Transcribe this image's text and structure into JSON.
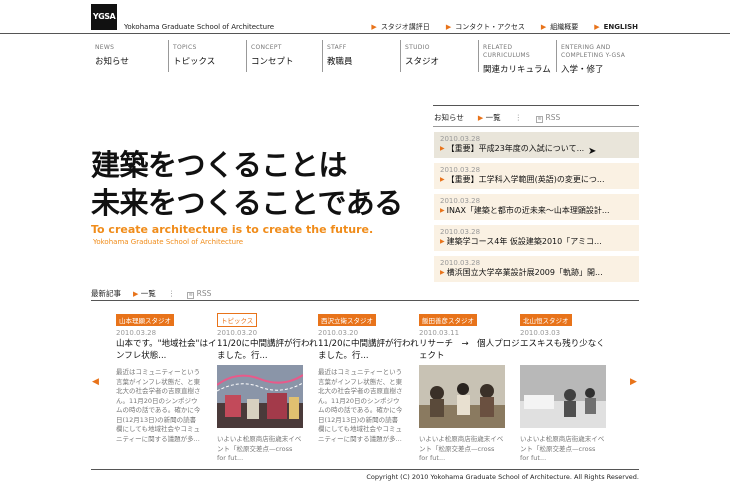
{
  "header": {
    "logo": "YGSA",
    "school_name": "Yokohama Graduate School of Architecture",
    "util_nav": [
      "スタジオ講評日",
      "コンタクト・アクセス",
      "組織概要",
      "ENGLISH"
    ]
  },
  "mainnav": [
    {
      "en": "NEWS",
      "jp": "お知らせ"
    },
    {
      "en": "TOPICS",
      "jp": "トピックス"
    },
    {
      "en": "CONCEPT",
      "jp": "コンセプト"
    },
    {
      "en": "STAFF",
      "jp": "教職員"
    },
    {
      "en": "STUDIO",
      "jp": "スタジオ"
    },
    {
      "en": "RELATED\nCURRICULUMS",
      "jp": "関連カリキュラム"
    },
    {
      "en": "ENTERING AND\nCOMPLETING Y-GSA",
      "jp": "入学・修了"
    }
  ],
  "hero": {
    "line1": "建築をつくることは",
    "line2": "未来をつくることである",
    "en": "To create architecture is to create the future.",
    "sub": "Yokohama Graduate School of Architecture"
  },
  "news": {
    "title": "お知らせ",
    "list_link": "一覧",
    "rss": "RSS",
    "items": [
      {
        "date": "2010.03.28",
        "title": "【重要】平成23年度の入試について..."
      },
      {
        "date": "2010.03.28",
        "title": "【重要】工学科入学範囲(英語)の変更につ..."
      },
      {
        "date": "2010.03.28",
        "title": "INAX「建築と都市の近未来〜山本理顕設計..."
      },
      {
        "date": "2010.03.28",
        "title": "建築学コース4年 仮設建築2010「アミコ..."
      },
      {
        "date": "2010.03.28",
        "title": "横浜国立大学卒業設計展2009「軌跡」開..."
      }
    ]
  },
  "latest": {
    "title": "最新記事",
    "list_link": "一覧",
    "rss": "RSS",
    "cards": [
      {
        "tag": "山本理顕スタジオ",
        "date": "2010.03.28",
        "title": "山本です。\"地域社会\"はインフレ状態...",
        "text": "最近はコミュニティーという言葉がインフレ状態だ、と東北大の社会学者の吉原直樹さん。11月20日のシンポジウムの時の話である。確かに今日(12月13日)の新聞の読書欄にしても地域社会やコミュニティーに関する議題が多..."
      },
      {
        "tag": "トピックス",
        "date": "2010.03.20",
        "title": "11/20に中間講評が行われました。行...",
        "sub": "いよいよ松原商店街歳末イベント「松原交差点—cross for fut..."
      },
      {
        "tag": "西沢立衛スタジオ",
        "date": "2010.03.20",
        "title": "11/20に中間講評が行われました。行...",
        "text": "最近はコミュニティーという言葉がインフレ状態だ、と東北大の社会学者の吉原直樹さん。11月20日のシンポジウムの時の話である。確かに今日(12月13日)の新聞の読書欄にしても地域社会やコミュニティーに関する議題が多..."
      },
      {
        "tag": "飯田善彦スタジオ",
        "date": "2010.03.11",
        "title": "リサーチ　→　個人プロジェクト",
        "sub": "いよいよ松原商店街歳末イベント「松原交差点—cross for fut..."
      },
      {
        "tag": "北山恒スタジオ",
        "date": "2010.03.03",
        "title": "エスキスも残り少なく",
        "sub": "いよいよ松原商店街歳末イベント「松原交差点—cross for fut..."
      }
    ]
  },
  "copyright": "Copyright (C) 2010 Yokohama Graduate School of Architecture. All Rights Reserved."
}
